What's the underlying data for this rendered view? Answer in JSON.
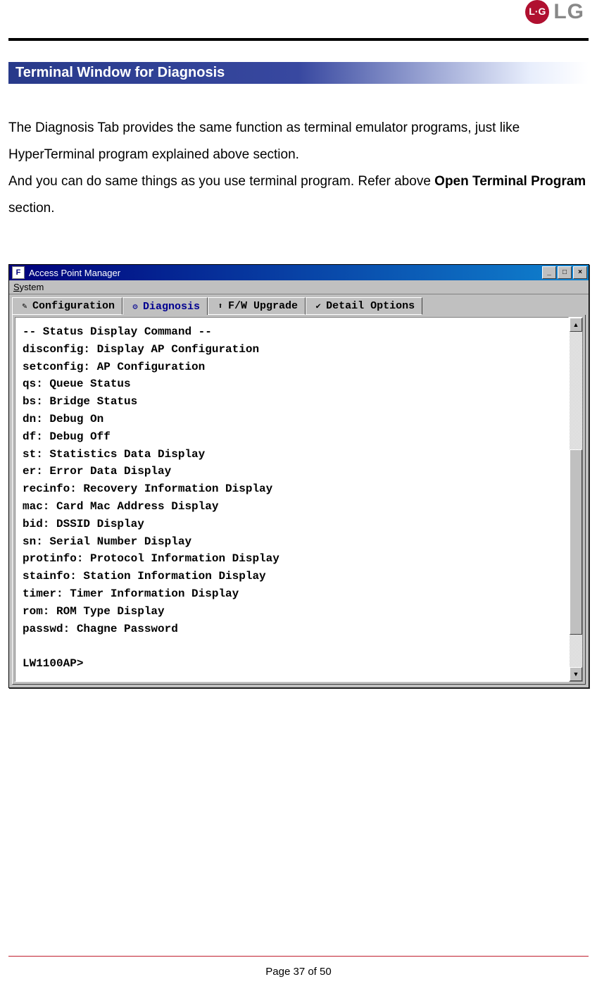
{
  "logo": {
    "circle_text": "L·G",
    "brand_text": "LG"
  },
  "section_heading": "Terminal Window for Diagnosis",
  "paragraph": {
    "line1": "The Diagnosis Tab provides the same function as terminal emulator programs, just like HyperTerminal program explained above section.",
    "line2a": "And you can do same things as you use terminal program. Refer above ",
    "bold": "Open Terminal Program",
    "line2b": " section."
  },
  "window": {
    "sys_icon_letter": "F",
    "title": "Access Point Manager",
    "win_btns": {
      "min": "_",
      "max": "□",
      "close": "×"
    },
    "menu": {
      "letter": "S",
      "rest": "ystem"
    },
    "tabs": [
      {
        "icon": "✎",
        "label": "Configuration",
        "active": false
      },
      {
        "icon": "⚙",
        "label": "Diagnosis",
        "active": true
      },
      {
        "icon": "⬆",
        "label": "F/W Upgrade",
        "active": false
      },
      {
        "icon": "✔",
        "label": "Detail Options",
        "active": false
      }
    ],
    "terminal_lines": [
      "-- Status Display Command --",
      "disconfig: Display AP Configuration",
      "setconfig: AP Configuration",
      "qs: Queue Status",
      "bs: Bridge Status",
      "dn: Debug On",
      "df: Debug Off",
      "st: Statistics Data Display",
      "er: Error Data Display",
      "recinfo: Recovery Information Display",
      "mac: Card Mac Address Display",
      "bid: DSSID Display",
      "sn: Serial Number Display",
      "protinfo: Protocol Information Display",
      "stainfo: Station Information Display",
      "timer: Timer Information Display",
      "rom: ROM Type Display",
      "passwd: Chagne Password",
      "",
      "LW1100AP>"
    ],
    "scroll": {
      "up": "▲",
      "down": "▼"
    }
  },
  "footer": "Page 37 of 50"
}
